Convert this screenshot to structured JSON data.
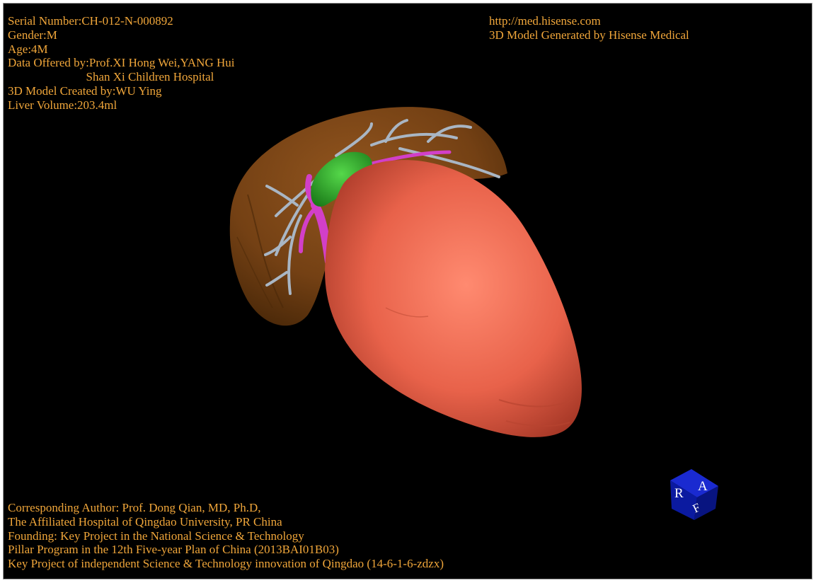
{
  "info_top_left": [
    "Serial Number:CH-012-N-000892",
    "Gender:M",
    "Age:4M",
    "Data Offered by:Prof.XI Hong Wei,YANG Hui",
    "                          Shan Xi Children Hospital",
    "3D Model Created by:WU Ying",
    "Liver Volume:203.4ml"
  ],
  "info_top_right": [
    "http://med.hisense.com",
    "3D Model Generated by Hisense Medical"
  ],
  "info_bottom": [
    "Corresponding Author: Prof. Dong Qian, MD, Ph.D,",
    "The Affiliated Hospital of Qingdao University, PR China",
    "Founding: Key Project in the National Science & Technology",
    "Pillar Program in the 12th Five-year Plan of China (2013BAI01B03)",
    "Key Project of independent Science & Technology innovation of Qingdao (14-6-1-6-zdzx)"
  ],
  "orientation_cube": {
    "labels": [
      "R",
      "A",
      "F"
    ],
    "color": "#0b1aa0"
  },
  "colors": {
    "text": "#f0a63a",
    "background": "#000000",
    "liver": "#7a4415",
    "spleen": "#e8624a",
    "gallbladder": "#2fb52a",
    "portal_vein": "#d23fc8",
    "hepatic_vessels": "#a9b6c4"
  }
}
